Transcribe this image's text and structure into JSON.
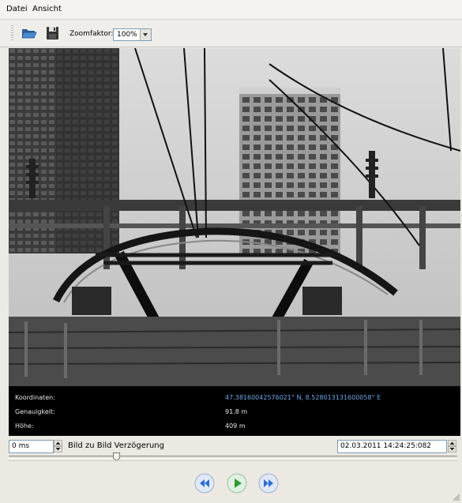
{
  "menubar": {
    "items": [
      {
        "label": "Datei"
      },
      {
        "label": "Ansicht"
      }
    ]
  },
  "toolbar": {
    "zoom_label": "Zoomfaktor:",
    "zoom_value": "100%",
    "icons": [
      "open-folder-icon",
      "save-icon"
    ]
  },
  "info": {
    "coordinates_label": "Koordinaten:",
    "coordinates_value": "47.38160042576021° N, 8.528013131600058° E",
    "accuracy_label": "Genauigkeit:",
    "accuracy_value": "91.8 m",
    "height_label": "Höhe:",
    "height_value": "409 m"
  },
  "controls": {
    "delay_value": "0 ms",
    "delay_label": "Bild zu Bild Verzögerung",
    "datetime_value": "02.03.2011 14:24:25:082",
    "slider_fraction": 0.24
  },
  "colors": {
    "coordinates_text": "#6aa6e8",
    "playback_button": "#2f6fd0",
    "play_green": "#2f9a35"
  }
}
